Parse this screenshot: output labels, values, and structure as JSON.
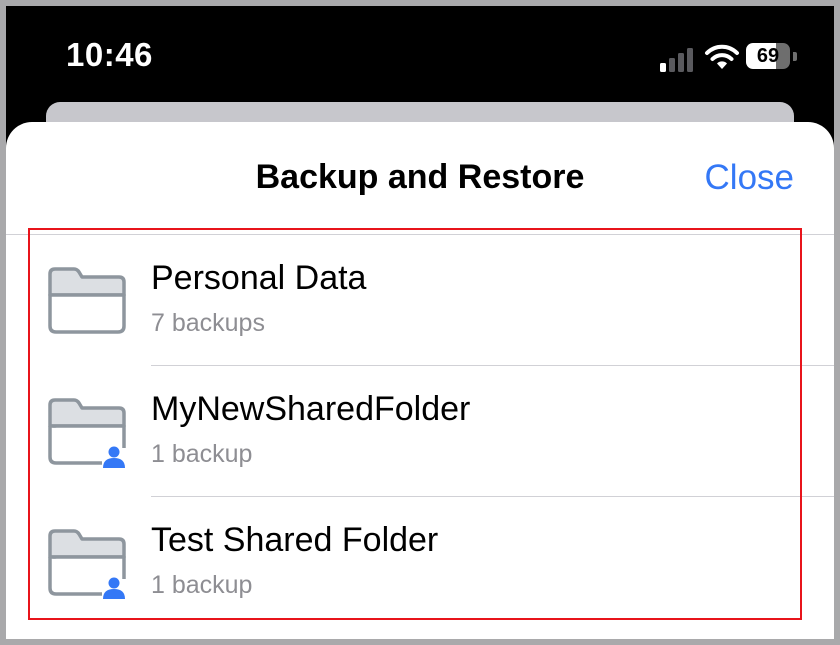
{
  "status_bar": {
    "time": "10:46",
    "battery_level": "69",
    "battery_fraction": 0.69,
    "signal_bars_active": 1,
    "signal_bars_total": 4
  },
  "sheet": {
    "title": "Backup and Restore",
    "close_label": "Close"
  },
  "folders": [
    {
      "name": "Personal Data",
      "count": "7 backups",
      "shared": false,
      "icon": "folder-icon"
    },
    {
      "name": "MyNewSharedFolder",
      "count": "1 backup",
      "shared": true,
      "icon": "shared-folder-icon"
    },
    {
      "name": "Test Shared Folder",
      "count": "1 backup",
      "shared": true,
      "icon": "shared-folder-icon"
    }
  ],
  "colors": {
    "accent": "#3478f6",
    "folder_fill": "#dcdfe3",
    "folder_stroke": "#8e969e",
    "highlight": "#e8141b"
  }
}
